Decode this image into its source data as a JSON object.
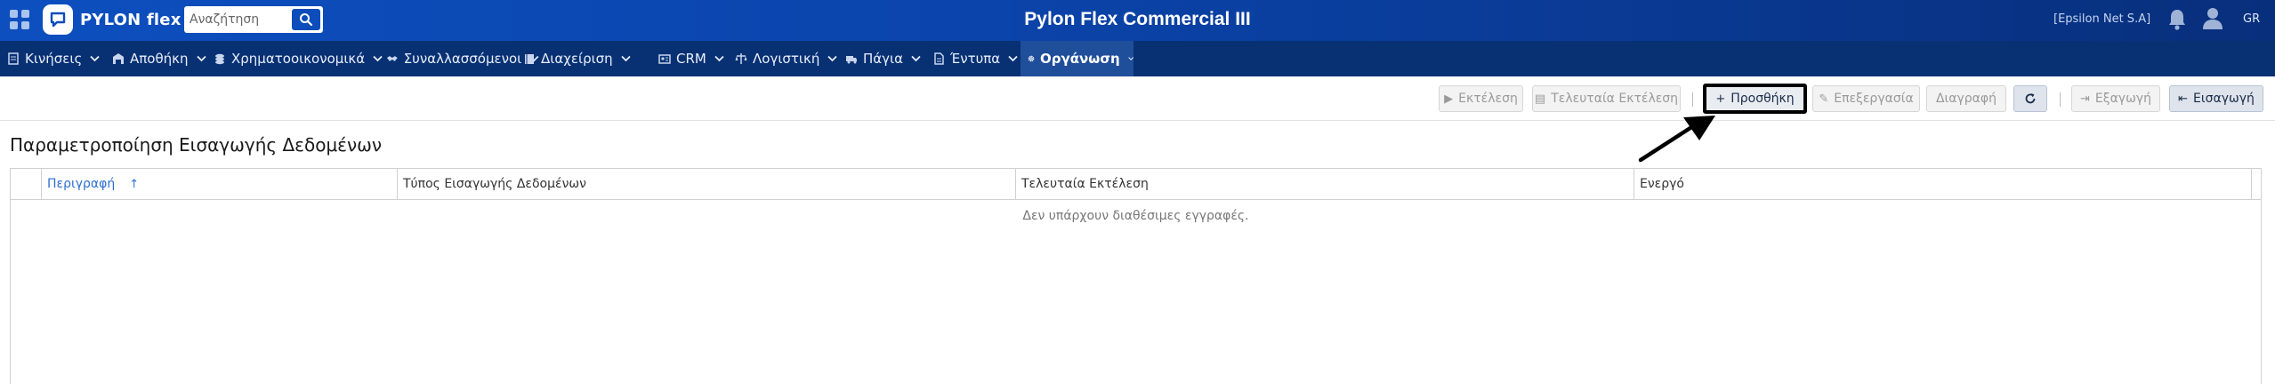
{
  "header": {
    "logo_text": "PYLON flex",
    "search": {
      "placeholder": "Αναζήτηση",
      "value": ""
    },
    "app_title": "Pylon Flex Commercial III",
    "company": "[Epsilon Net S.A]",
    "language": "GR",
    "colors": {
      "top_bar": "#0d4fbf",
      "nav_bar": "#083174",
      "accent": "#2e6fd0"
    }
  },
  "nav": {
    "items": [
      {
        "label": "Κινήσεις",
        "icon": "document-icon"
      },
      {
        "label": "Αποθήκη",
        "icon": "warehouse-icon"
      },
      {
        "label": "Χρηματοοικονομικά",
        "icon": "coins-icon"
      },
      {
        "label": "Συναλλασσόμενοι",
        "icon": "handshake-icon"
      },
      {
        "label": "Διαχείριση",
        "icon": "book-icon"
      },
      {
        "label": "CRM",
        "icon": "contact-card-icon"
      },
      {
        "label": "Λογιστική",
        "icon": "scale-icon"
      },
      {
        "label": "Πάγια",
        "icon": "truck-icon"
      },
      {
        "label": "Έντυπα",
        "icon": "file-icon"
      },
      {
        "label": "Οργάνωση",
        "icon": "gear-icon",
        "active": true
      }
    ]
  },
  "toolbar": {
    "run": "Εκτέλεση",
    "last_run": "Τελευταία Εκτέλεση",
    "add": "Προσθήκη",
    "edit": "Επεξεργασία",
    "delete": "Διαγραφή",
    "export": "Εξαγωγή",
    "import": "Εισαγωγή"
  },
  "page": {
    "title": "Παραμετροποίηση Εισαγωγής Δεδομένων"
  },
  "grid": {
    "columns": [
      "Περιγραφή",
      "Τύπος Εισαγωγής Δεδομένων",
      "Τελευταία Εκτέλεση",
      "Ενεργό"
    ],
    "sorted_column": "Περιγραφή",
    "sort_direction": "ascending",
    "rows": [],
    "empty_message": "Δεν υπάρχουν διαθέσιμες εγγραφές."
  }
}
